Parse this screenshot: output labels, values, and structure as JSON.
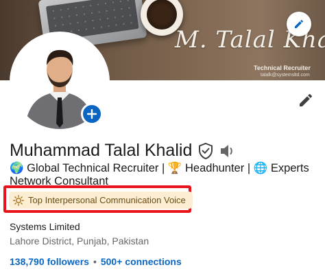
{
  "banner": {
    "signature": "M. Talal Khalid",
    "role": "Technical Recruiter",
    "email": "talalk@systemsltd.com"
  },
  "profile": {
    "name": "Muhammad Talal Khalid",
    "headline": "🌍 Global Technical Recruiter | 🏆 Headhunter | 🌐 Experts Network Consultant",
    "badge": "Top Interpersonal Communication Voice",
    "company": "Systems Limited",
    "location": "Lahore District, Punjab, Pakistan",
    "followers": "138,790 followers",
    "separator": "•",
    "connections": "500+ connections"
  },
  "icons": {
    "edit_banner": "pencil-icon",
    "edit_profile": "pencil-icon",
    "add_photo": "plus-icon",
    "verified": "shield-check-icon",
    "pronunciation": "speaker-icon",
    "badge": "sun-icon"
  },
  "colors": {
    "accent": "#0a66c2",
    "highlight_border": "#e8131b",
    "badge_bg": "#fbeed3",
    "badge_text": "#6b4a12"
  }
}
